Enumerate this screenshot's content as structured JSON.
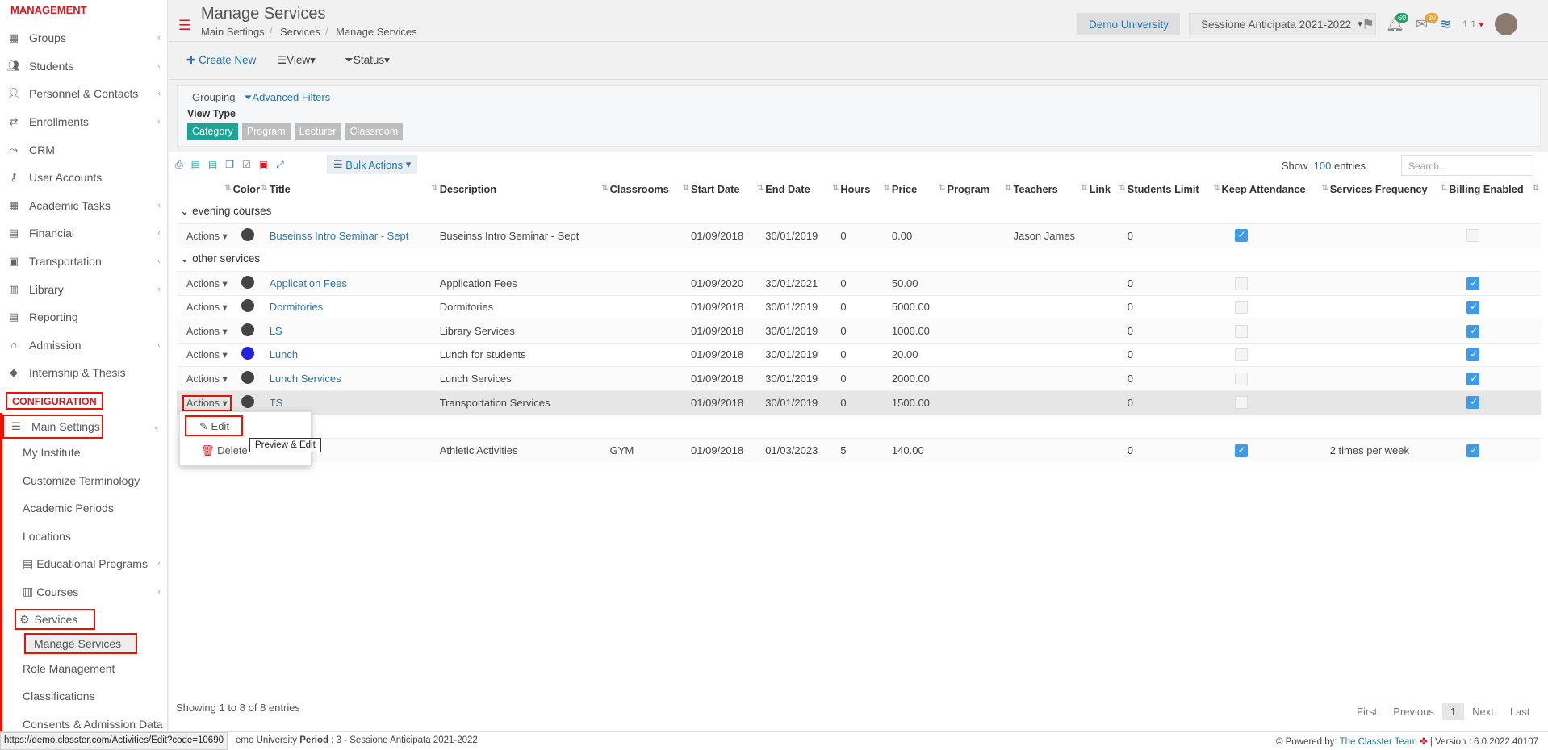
{
  "sidebar": {
    "management_label": "MANAGEMENT",
    "items": [
      {
        "label": "Groups",
        "icon": "groups-icon"
      },
      {
        "label": "Students",
        "icon": "students-icon"
      },
      {
        "label": "Personnel & Contacts",
        "icon": "personnel-icon"
      },
      {
        "label": "Enrollments",
        "icon": "enrollments-icon"
      },
      {
        "label": "CRM",
        "icon": "crm-icon"
      },
      {
        "label": "User Accounts",
        "icon": "key-icon"
      },
      {
        "label": "Academic Tasks",
        "icon": "tasks-icon"
      },
      {
        "label": "Financial",
        "icon": "financial-icon"
      },
      {
        "label": "Transportation",
        "icon": "bus-icon"
      },
      {
        "label": "Library",
        "icon": "library-icon"
      },
      {
        "label": "Reporting",
        "icon": "reporting-icon"
      },
      {
        "label": "Admission",
        "icon": "admission-icon"
      },
      {
        "label": "Internship & Thesis",
        "icon": "internship-icon"
      }
    ],
    "configuration_label": "CONFIGURATION",
    "main_settings": "Main Settings",
    "sub_items": [
      {
        "label": "My Institute"
      },
      {
        "label": "Customize Terminology"
      },
      {
        "label": "Academic Periods"
      },
      {
        "label": "Locations"
      },
      {
        "label": "Educational Programs"
      },
      {
        "label": "Courses"
      }
    ],
    "services": "Services",
    "manage_services": "Manage Services",
    "role_management": "Role Management",
    "classifications": "Classifications",
    "consents": "Consents & Admission Data"
  },
  "header": {
    "title": "Manage Services",
    "crumbs": [
      "Main Settings",
      "Services",
      "Manage Services"
    ],
    "university": "Demo University",
    "period": "Sessione Anticipata 2021-2022",
    "notif_count": "60",
    "mail_count": "30",
    "user_short": "1 1"
  },
  "toolbar": {
    "create_new": "Create New",
    "view": "View",
    "status": "Status"
  },
  "filters": {
    "grouping": "Grouping",
    "advanced_filters": "Advanced Filters",
    "view_type": "View Type",
    "view_types": [
      "Category",
      "Program",
      "Lecturer",
      "Classroom"
    ]
  },
  "table": {
    "bulk_actions": "Bulk Actions",
    "show": "Show",
    "entries_count": "100",
    "entries": "entries",
    "search_placeholder": "Search...",
    "columns": [
      "Color",
      "Title",
      "Description",
      "Classrooms",
      "Start Date",
      "End Date",
      "Hours",
      "Price",
      "Program",
      "Teachers",
      "Link",
      "Students Limit",
      "Keep Attendance",
      "Services Frequency",
      "Billing Enabled"
    ],
    "groups": [
      {
        "name": "evening courses",
        "rows": [
          {
            "actions": "Actions",
            "color": "#444444",
            "title": "Buseinss Intro Seminar - Sept",
            "description": "Buseinss Intro Seminar - Sept",
            "classrooms": "",
            "start": "01/09/2018",
            "end": "30/01/2019",
            "hours": "0",
            "price": "0.00",
            "program": "",
            "teachers": "Jason James",
            "link": "",
            "limit": "0",
            "attendance": true,
            "frequency": "",
            "billing": false
          }
        ]
      },
      {
        "name": "other services",
        "rows": [
          {
            "actions": "Actions",
            "color": "#444444",
            "title": "Application Fees",
            "description": "Application Fees",
            "classrooms": "",
            "start": "01/09/2020",
            "end": "30/01/2021",
            "hours": "0",
            "price": "50.00",
            "program": "",
            "teachers": "",
            "link": "",
            "limit": "0",
            "attendance": false,
            "frequency": "",
            "billing": true
          },
          {
            "actions": "Actions",
            "color": "#444444",
            "title": "Dormitories",
            "description": "Dormitories",
            "classrooms": "",
            "start": "01/09/2018",
            "end": "30/01/2019",
            "hours": "0",
            "price": "5000.00",
            "program": "",
            "teachers": "",
            "link": "",
            "limit": "0",
            "attendance": false,
            "frequency": "",
            "billing": true
          },
          {
            "actions": "Actions",
            "color": "#444444",
            "title": "LS",
            "description": "Library Services",
            "classrooms": "",
            "start": "01/09/2018",
            "end": "30/01/2019",
            "hours": "0",
            "price": "1000.00",
            "program": "",
            "teachers": "",
            "link": "",
            "limit": "0",
            "attendance": false,
            "frequency": "",
            "billing": true
          },
          {
            "actions": "Actions",
            "color": "#2222dd",
            "title": "Lunch",
            "description": "Lunch for students",
            "classrooms": "",
            "start": "01/09/2018",
            "end": "30/01/2019",
            "hours": "0",
            "price": "20.00",
            "program": "",
            "teachers": "",
            "link": "",
            "limit": "0",
            "attendance": false,
            "frequency": "",
            "billing": true
          },
          {
            "actions": "Actions",
            "color": "#444444",
            "title": "Lunch Services",
            "description": "Lunch Services",
            "classrooms": "",
            "start": "01/09/2018",
            "end": "30/01/2019",
            "hours": "0",
            "price": "2000.00",
            "program": "",
            "teachers": "",
            "link": "",
            "limit": "0",
            "attendance": false,
            "frequency": "",
            "billing": true
          },
          {
            "actions": "Actions",
            "color": "#444444",
            "title": "TS",
            "description": "Transportation Services",
            "classrooms": "",
            "start": "01/09/2018",
            "end": "30/01/2019",
            "hours": "0",
            "price": "1500.00",
            "program": "",
            "teachers": "",
            "link": "",
            "limit": "0",
            "attendance": false,
            "frequency": "",
            "billing": true
          }
        ]
      },
      {
        "name": "",
        "rows": [
          {
            "actions": "",
            "color": "",
            "title": "",
            "description": "Athletic Activities",
            "classrooms": "GYM",
            "start": "01/09/2018",
            "end": "01/03/2023",
            "hours": "5",
            "price": "140.00",
            "program": "",
            "teachers": "",
            "link": "",
            "limit": "0",
            "attendance": true,
            "frequency": "2 times per week",
            "billing": true
          }
        ]
      }
    ],
    "showing": "Showing 1 to 8 of 8 entries",
    "pager": [
      "First",
      "Previous",
      "1",
      "Next",
      "Last"
    ]
  },
  "dropdown": {
    "edit": "Edit",
    "delete": "Delete",
    "tooltip": "Preview & Edit"
  },
  "statusbar": {
    "url": "https://demo.classter.com/Activities/Edit?code=10690",
    "text_pre": "emo University ",
    "period_label": "Period",
    "period_value": " : 3 - Sessione Anticipata 2021-2022",
    "powered_label": "Powered by: ",
    "powered_team": "The Classter Team",
    "version": " | Version : 6.0.2022.40107"
  }
}
